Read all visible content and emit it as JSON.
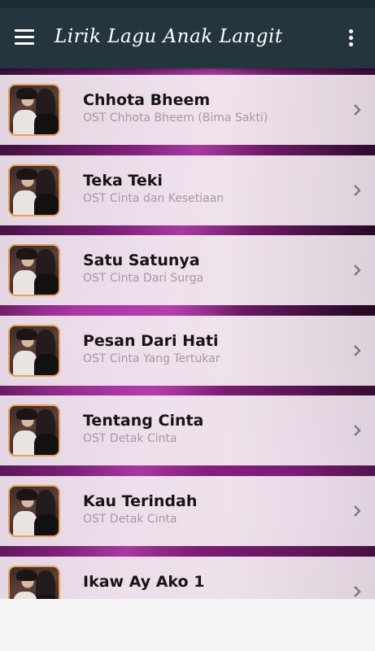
{
  "app_bar": {
    "title": "Lirik Lagu Anak Langit",
    "menu_icon": "hamburger-menu-icon",
    "overflow_icon": "more-vertical-icon",
    "background_color": "#253540"
  },
  "songs": [
    {
      "title": "Chhota Bheem",
      "subtitle": "OST Chhota Bheem (Bima Sakti)"
    },
    {
      "title": "Teka Teki",
      "subtitle": "OST Cinta dan Kesetiaan"
    },
    {
      "title": "Satu Satunya",
      "subtitle": "OST Cinta Dari Surga"
    },
    {
      "title": "Pesan Dari Hati",
      "subtitle": "OST Cinta Yang Tertukar"
    },
    {
      "title": "Tentang Cinta",
      "subtitle": "OST Detak Cinta"
    },
    {
      "title": "Kau Terindah",
      "subtitle": "OST Detak Cinta"
    },
    {
      "title": "Ikaw Ay Ako 1",
      "subtitle": ""
    }
  ],
  "thumbnail_border_color": "#e8a15a",
  "chevron_icon": "chevron-right-icon"
}
